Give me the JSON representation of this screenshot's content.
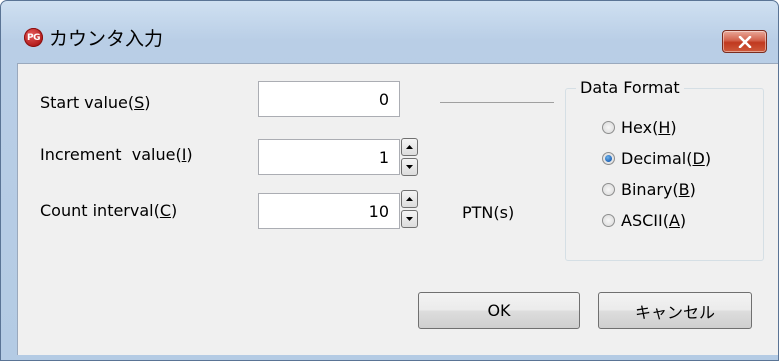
{
  "window": {
    "title": "カウンタ入力",
    "app_icon_text": "PG"
  },
  "fields": {
    "start_value": {
      "label": "Start value(",
      "mnemonic": "S",
      "label_end": ")",
      "value": "0"
    },
    "increment_value": {
      "label": "Increment  value(",
      "mnemonic": "I",
      "label_end": ")",
      "value": "1"
    },
    "count_interval": {
      "label": "Count interval(",
      "mnemonic": "C",
      "label_end": ")",
      "value": "10",
      "unit": "PTN(s)"
    }
  },
  "data_format": {
    "title": "Data Format",
    "options": [
      {
        "label": "Hex(",
        "mnemonic": "H",
        "label_end": ")",
        "checked": false
      },
      {
        "label": "Decimal(",
        "mnemonic": "D",
        "label_end": ")",
        "checked": true
      },
      {
        "label": "Binary(",
        "mnemonic": "B",
        "label_end": ")",
        "checked": false
      },
      {
        "label": "ASCII(",
        "mnemonic": "A",
        "label_end": ")",
        "checked": false
      }
    ]
  },
  "buttons": {
    "ok": "OK",
    "cancel": "キャンセル"
  }
}
